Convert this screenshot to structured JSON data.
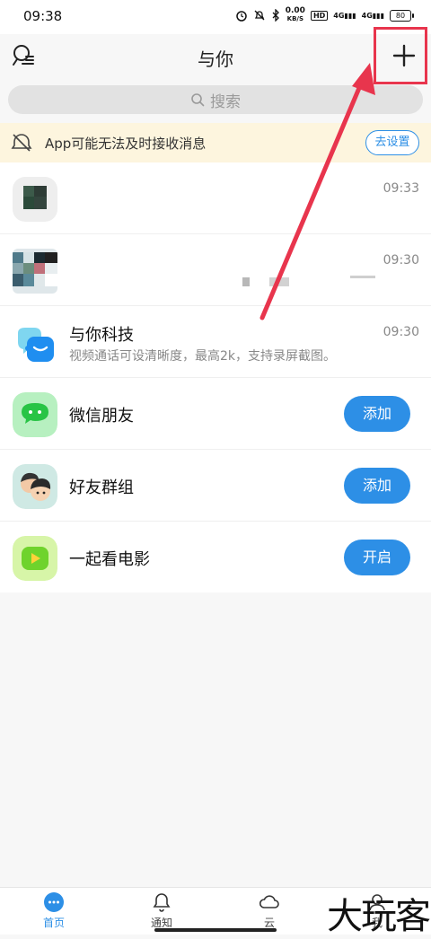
{
  "status_bar": {
    "time": "09:38",
    "net_speed_value": "0.00",
    "net_speed_unit": "KB/S",
    "hd_label": "HD",
    "signal1": "4G",
    "signal2": "4G",
    "battery": "80"
  },
  "header": {
    "title": "与你",
    "profile_icon": "profile-icon",
    "plus_icon": "plus-icon"
  },
  "search": {
    "placeholder": "搜索"
  },
  "notice": {
    "text": "App可能无法及时接收消息",
    "button": "去设置"
  },
  "chats": [
    {
      "name": "",
      "time": "09:33"
    },
    {
      "name": "",
      "time": "09:30"
    },
    {
      "name": "与你科技",
      "message": "视频通话可设清晰度，最高2k，支持录屏截图。",
      "time": "09:30"
    }
  ],
  "features": [
    {
      "name": "微信朋友",
      "button": "添加",
      "icon": "wechat-icon"
    },
    {
      "name": "好友群组",
      "button": "添加",
      "icon": "group-icon"
    },
    {
      "name": "一起看电影",
      "button": "开启",
      "icon": "movie-icon"
    }
  ],
  "tabbar": {
    "tabs": [
      {
        "label": "首页",
        "active": true
      },
      {
        "label": "通知",
        "active": false
      },
      {
        "label": "云",
        "active": false
      },
      {
        "label": "我",
        "active": false
      }
    ]
  },
  "watermark": "大玩客",
  "colors": {
    "accent": "#2d8fe6",
    "annotation": "#e8354d",
    "notice_bg": "#fdf5de"
  }
}
